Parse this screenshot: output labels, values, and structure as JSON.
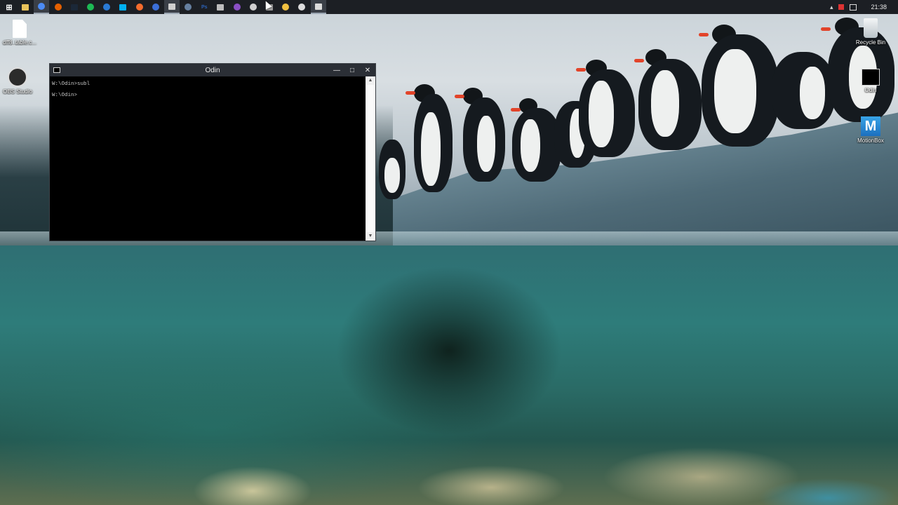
{
  "taskbar": {
    "apps": [
      {
        "name": "start-icon",
        "glyph": "⊞",
        "color": "#ffffff"
      },
      {
        "name": "file-explorer-icon",
        "glyph": "",
        "color": "#e8c25a"
      },
      {
        "name": "chrome-icon",
        "glyph": "",
        "color": "#4c8bf5"
      },
      {
        "name": "firefox-icon",
        "glyph": "",
        "color": "#e66000"
      },
      {
        "name": "steam-icon",
        "glyph": "",
        "color": "#1b2838"
      },
      {
        "name": "spotify-icon",
        "glyph": "",
        "color": "#1db954"
      },
      {
        "name": "edge-icon",
        "glyph": "",
        "color": "#2a7ad4"
      },
      {
        "name": "skype-icon",
        "glyph": "",
        "color": "#00aff0"
      },
      {
        "name": "origin-icon",
        "glyph": "",
        "color": "#f56c2d"
      },
      {
        "name": "app-window-icon",
        "glyph": "",
        "color": "#3b6fd8"
      },
      {
        "name": "notepad-icon",
        "glyph": "",
        "color": "#cfcfcf"
      },
      {
        "name": "dots-icon",
        "glyph": "",
        "color": "#6680a0"
      },
      {
        "name": "photoshop-icon",
        "glyph": "Ps",
        "color": "#2c63b9"
      },
      {
        "name": "clock-app-icon",
        "glyph": "",
        "color": "#bdbdbd"
      },
      {
        "name": "visual-studio-icon",
        "glyph": "",
        "color": "#8a4fc4"
      },
      {
        "name": "obs-icon",
        "glyph": "",
        "color": "#cfcfcf"
      },
      {
        "name": "settings-icon",
        "glyph": "",
        "color": "#9a9a9a"
      },
      {
        "name": "pin-icon",
        "glyph": "",
        "color": "#f0c040"
      },
      {
        "name": "terminal-small-icon",
        "glyph": "",
        "color": "#dcdcdc"
      },
      {
        "name": "cmd-icon",
        "glyph": "",
        "color": "#dcdcdc"
      }
    ],
    "tray": {
      "chevron": "▴",
      "clock": "21:38"
    }
  },
  "desktop": {
    "icons_left": [
      {
        "label": "dff8_table.c...",
        "name": "file-icon"
      },
      {
        "label": "OBS Studio",
        "name": "obs-studio-icon"
      }
    ],
    "icons_right": [
      {
        "label": "Recycle Bin",
        "name": "recycle-bin-icon"
      },
      {
        "label": "Odin",
        "name": "odin-shortcut-icon"
      },
      {
        "label": "MotionBox",
        "name": "motionbox-icon"
      }
    ]
  },
  "window": {
    "title": "Odin",
    "minimize": "—",
    "maximize": "□",
    "close": "✕",
    "lines": [
      "W:\\Odin>subl",
      "W:\\Odin>"
    ]
  }
}
